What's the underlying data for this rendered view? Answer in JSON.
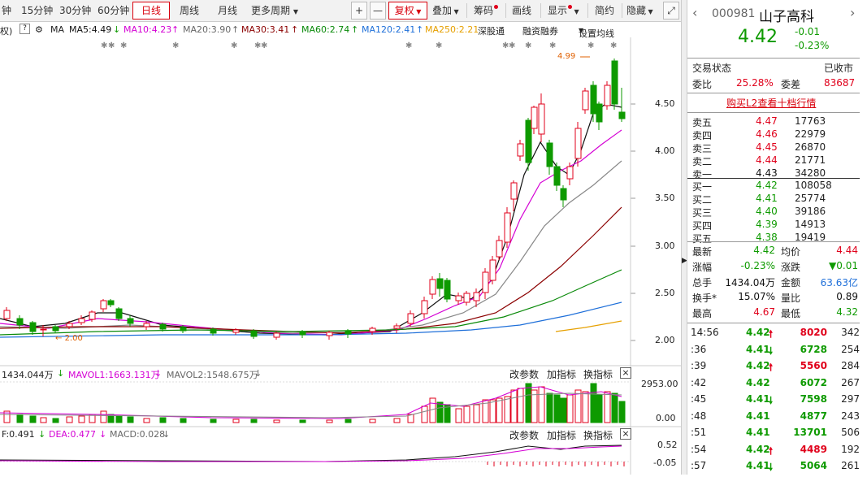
{
  "toolbar": {
    "periods": [
      "钟",
      "15分钟",
      "30分钟",
      "60分钟",
      "日线",
      "周线",
      "月线",
      "更多周期"
    ],
    "active_period": "日线",
    "plus": "+",
    "minus": "—",
    "fuquan": "复权",
    "diejia": "叠加",
    "chouma": "筹码",
    "huaxian": "画线",
    "xianshi": "显示",
    "jianyue": "简约",
    "yincang": "隐藏"
  },
  "ma_bar": {
    "prefix": "权)",
    "help": "?",
    "ma": "MA",
    "ma5": "MA5:4.49",
    "ma10": "MA10:4.23",
    "ma20": "MA20:3.90",
    "ma30": "MA30:3.41",
    "ma60": "MA60:2.74",
    "ma120": "MA120:2.41",
    "ma250": "MA250:2.21",
    "shengutong": "深股通",
    "rongzi": "融资融券",
    "shezhi": "设置均线"
  },
  "price_axis": [
    "4.50",
    "4.00",
    "3.50",
    "3.00",
    "2.50",
    "2.00"
  ],
  "annotations": {
    "high": "4.99",
    "low": "2.00"
  },
  "vol_bar": {
    "vol": "1434.044万",
    "mavol1": "MAVOL1:1663.131万",
    "mavol2": "MAVOL2:1548.675万",
    "gaicanshu": "改参数",
    "jiazhibiao": "加指标",
    "huanzhibiao": "换指标",
    "close": "×",
    "axis_top": "2953.00",
    "axis_bottom": "0.00"
  },
  "macd_bar": {
    "dif": "F:0.491",
    "dea": "DEA:0.477",
    "macd": "MACD:0.028",
    "gaicanshu": "改参数",
    "jiazhibiao": "加指标",
    "huanzhibiao": "换指标",
    "close": "×",
    "axis_top": "0.52",
    "axis_bottom": "-0.05"
  },
  "quote": {
    "code": "000981",
    "name": "山子高科",
    "price": "4.42",
    "change": "-0.01",
    "change_pct": "-0.23%",
    "status_label": "交易状态",
    "status": "已收市",
    "weibi_label": "委比",
    "weibi": "25.28%",
    "weicha_label": "委差",
    "weicha": "83687",
    "l2_link": "购买L2查看十档行情",
    "asks": [
      {
        "label": "卖五",
        "price": "4.47",
        "vol": "17763",
        "color": "red"
      },
      {
        "label": "卖四",
        "price": "4.46",
        "vol": "22979",
        "color": "red"
      },
      {
        "label": "卖三",
        "price": "4.45",
        "vol": "26870",
        "color": "red"
      },
      {
        "label": "卖二",
        "price": "4.44",
        "vol": "21771",
        "color": "red"
      },
      {
        "label": "卖一",
        "price": "4.43",
        "vol": "34280",
        "color": "black"
      }
    ],
    "bids": [
      {
        "label": "买一",
        "price": "4.42",
        "vol": "108058",
        "color": "green"
      },
      {
        "label": "买二",
        "price": "4.41",
        "vol": "25774",
        "color": "green"
      },
      {
        "label": "买三",
        "price": "4.40",
        "vol": "39186",
        "color": "green"
      },
      {
        "label": "买四",
        "price": "4.39",
        "vol": "14913",
        "color": "green"
      },
      {
        "label": "买五",
        "price": "4.38",
        "vol": "19419",
        "color": "green"
      }
    ],
    "stats": [
      {
        "l1": "最新",
        "v1": "4.42",
        "c1": "green",
        "l2": "均价",
        "v2": "4.44",
        "c2": "red"
      },
      {
        "l1": "涨幅",
        "v1": "-0.23%",
        "c1": "green",
        "l2": "涨跌",
        "v2": "▼0.01",
        "c2": "green"
      },
      {
        "l1": "总手",
        "v1": "1434.04万",
        "c1": "black",
        "l2": "金额",
        "v2": "63.63亿",
        "c2": "blue"
      },
      {
        "l1": "换手*",
        "v1": "15.07%",
        "c1": "black",
        "l2": "量比",
        "v2": "0.89",
        "c2": "black"
      },
      {
        "l1": "最高",
        "v1": "4.67",
        "c1": "red",
        "l2": "最低",
        "v2": "4.32",
        "c2": "green"
      }
    ],
    "ticks": [
      {
        "time": "14:56",
        "price": "4.42",
        "dir": "up",
        "vol": "8020",
        "n": "342"
      },
      {
        "time": ":36",
        "price": "4.41",
        "dir": "down",
        "vol": "6728",
        "n": "254"
      },
      {
        "time": ":39",
        "price": "4.42",
        "dir": "up",
        "vol": "5560",
        "n": "284"
      },
      {
        "time": ":42",
        "price": "4.42",
        "dir": "",
        "vol": "6072",
        "n": "267"
      },
      {
        "time": ":45",
        "price": "4.41",
        "dir": "down",
        "vol": "7598",
        "n": "297"
      },
      {
        "time": ":48",
        "price": "4.41",
        "dir": "",
        "vol": "4877",
        "n": "243"
      },
      {
        "time": ":51",
        "price": "4.41",
        "dir": "",
        "vol": "13701",
        "n": "506"
      },
      {
        "time": ":54",
        "price": "4.42",
        "dir": "up",
        "vol": "4489",
        "n": "192"
      },
      {
        "time": ":57",
        "price": "4.41",
        "dir": "down",
        "vol": "5064",
        "n": "261"
      }
    ]
  },
  "colors": {
    "up": "#e0001b",
    "down": "#0e9a00",
    "ma5": "#111111",
    "ma10": "#d400d4",
    "ma20": "#888888",
    "ma30": "#8b0000",
    "ma60": "#0a8a0a",
    "ma120": "#1e6fd9",
    "ma250": "#e6a000"
  }
}
